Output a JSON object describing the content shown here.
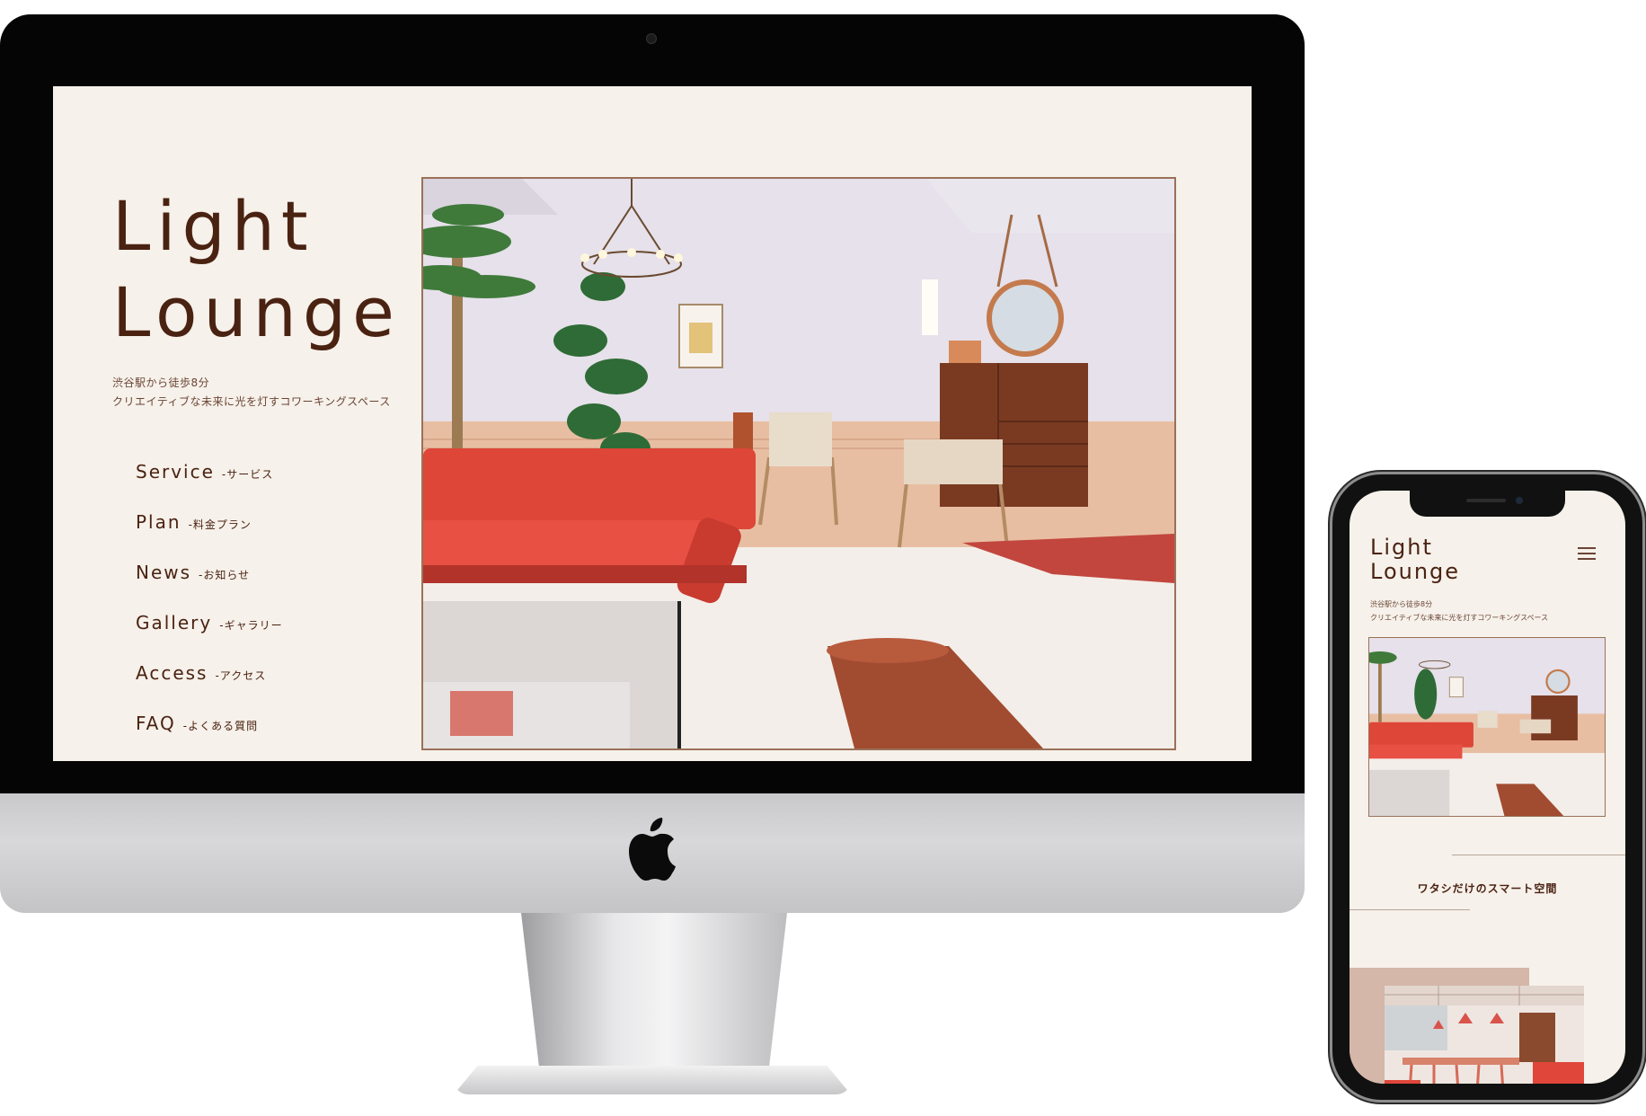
{
  "site": {
    "brand_line1": "Light",
    "brand_line2": "Lounge",
    "tagline_line1": "渋谷駅から徒歩8分",
    "tagline_line2": "クリエイティブな未来に光を灯すコワーキングスペース"
  },
  "nav": [
    {
      "en": "Service",
      "jp": "-サービス"
    },
    {
      "en": "Plan",
      "jp": "-料金プラン"
    },
    {
      "en": "News",
      "jp": "-お知らせ"
    },
    {
      "en": "Gallery",
      "jp": "-ギャラリー"
    },
    {
      "en": "Access",
      "jp": "-アクセス"
    },
    {
      "en": "FAQ",
      "jp": "-よくある質問"
    }
  ],
  "mobile": {
    "brand_line1": "Light",
    "brand_line2": "Lounge",
    "tagline_line1": "渋谷駅から徒歩8分",
    "tagline_line2": "クリエイティブな未来に光を灯すコワーキングスペース",
    "section_heading": "ワタシだけのスマート空間",
    "menu_icon": "hamburger-menu-icon"
  },
  "colors": {
    "background": "#f6f1ea",
    "text_brown": "#4a2212",
    "frame_brown": "#9a7158",
    "sofa_red": "#e2463a"
  }
}
